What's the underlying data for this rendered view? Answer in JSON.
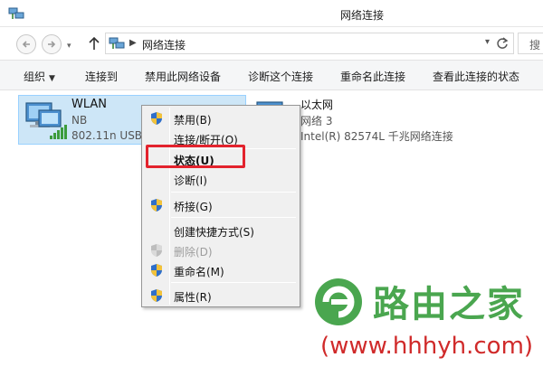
{
  "window": {
    "title": "网络连接"
  },
  "address": {
    "path": "网络连接",
    "search_placeholder": "搜"
  },
  "toolbar": {
    "organize": "组织",
    "connect_to": "连接到",
    "disable_device": "禁用此网络设备",
    "diagnose": "诊断这个连接",
    "rename": "重命名此连接",
    "view_status": "查看此连接的状态"
  },
  "adapters": {
    "wlan": {
      "name": "WLAN",
      "network": "NB",
      "device": "802.11n USB"
    },
    "ethernet": {
      "name": "以太网",
      "network": "网络  3",
      "device": "Intel(R) 82574L 千兆网络连接"
    }
  },
  "context_menu": {
    "disable": "禁用(B)",
    "connect_disconnect": "连接/断开(O)",
    "status": "状态(U)",
    "diagnose": "诊断(I)",
    "bridge": "桥接(G)",
    "create_shortcut": "创建快捷方式(S)",
    "delete": "删除(D)",
    "rename": "重命名(M)",
    "properties": "属性(R)"
  },
  "watermark": {
    "brand": "路由之家",
    "url": "(www.hhhyh.com)"
  },
  "colors": {
    "selection_bg": "#cde6f7",
    "highlight_border": "#e3232d",
    "brand_green": "#4aa64f",
    "url_red": "#d02a2a"
  },
  "icons": {
    "shield": "uac-shield-icon",
    "network": "network-adapter-icon"
  }
}
